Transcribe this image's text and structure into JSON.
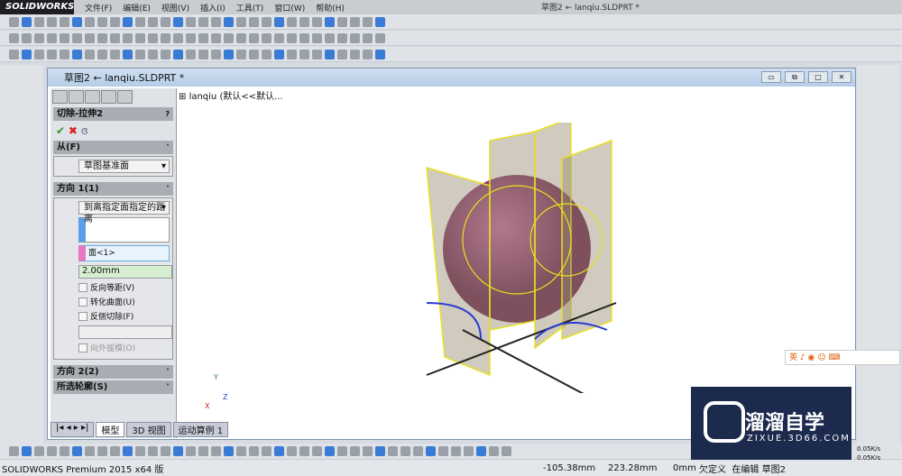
{
  "app": {
    "brand": "SOLIDWORKS",
    "title": "草图2 ← lanqiu.SLDPRT *"
  },
  "menu": [
    "文件(F)",
    "编辑(E)",
    "视图(V)",
    "插入(I)",
    "工具(T)",
    "窗口(W)",
    "帮助(H)"
  ],
  "window": {
    "title": "草图2 ← lanqiu.SLDPRT *"
  },
  "feature_tree": {
    "root": "lanqiu  (默认<<默认..."
  },
  "property_manager": {
    "title": "切除-拉伸2",
    "help": "?",
    "from": {
      "header": "从(F)",
      "value": "草图基准面"
    },
    "direction1": {
      "header": "方向 1(1)",
      "end_condition": "到离指定面指定的距离",
      "face": "面<1>",
      "distance": "2.00mm",
      "options": [
        "反向等距(V)",
        "转化曲面(U)",
        "反侧切除(F)"
      ],
      "draft": "向外拔模(O)"
    },
    "direction2": {
      "header": "方向 2(2)"
    },
    "contours": {
      "header": "所选轮廓(S)"
    }
  },
  "view_tabs": [
    "模型",
    "3D 视图",
    "运动算例 1"
  ],
  "triad": {
    "x": "X",
    "y": "Y",
    "z": "Z"
  },
  "status": {
    "product": "SOLIDWORKS Premium 2015 x64 版",
    "x": "-105.38mm",
    "y": "223.28mm",
    "z": "0mm",
    "state": "欠定义",
    "editing": "在编辑 草图2"
  },
  "watermark": {
    "name": "溜溜自学",
    "url": "ZIXUE.3D66.COM"
  },
  "net": {
    "up": "0.05K/s",
    "down": "0.05K/s"
  },
  "ime": {
    "label": "英"
  }
}
